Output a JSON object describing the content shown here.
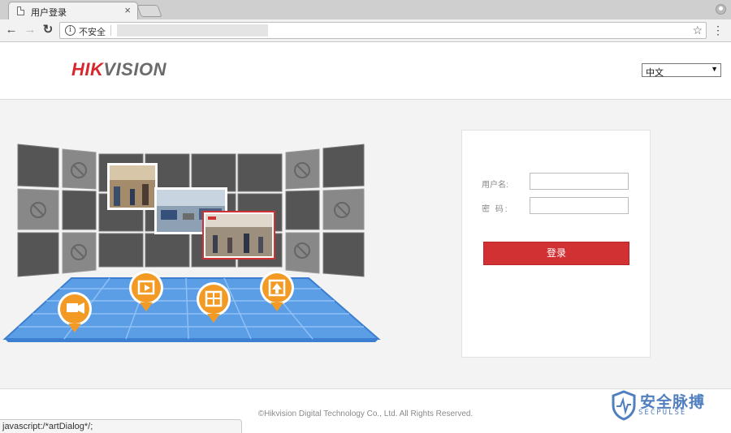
{
  "browser": {
    "tab_title": "用户登录",
    "tab_close": "×",
    "security_label": "不安全",
    "info_icon": "i",
    "back": "←",
    "forward": "→",
    "reload": "↻",
    "star": "☆",
    "menu": "⋮"
  },
  "header": {
    "logo_hik": "HIK",
    "logo_vision": "VISION",
    "language": "中文",
    "language_arrow": "▼"
  },
  "login": {
    "username_label": "用户名:",
    "password_label": "密 码:",
    "submit_label": "登录"
  },
  "footer": {
    "copyright": "©Hikvision Digital Technology Co., Ltd. All Rights Reserved.",
    "status_text": "javascript:/*artDialog*/;"
  },
  "watermark": {
    "title": "安全脉搏",
    "subtitle": "SECPULSE"
  },
  "colors": {
    "brand_red": "#d7282f",
    "button_red": "#d23134",
    "floor_blue": "#5b9ee6",
    "pin_orange": "#f39a24"
  }
}
